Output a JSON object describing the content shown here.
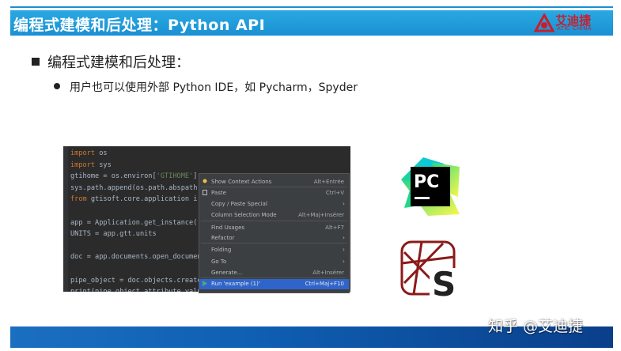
{
  "slide": {
    "title": "编程式建模和后处理：Python API",
    "heading": "编程式建模和后处理：",
    "bullet": "用户也可以使用外部 Python IDE，如 Pycharm，Spyder",
    "watermark": "知乎 @艾迪捷"
  },
  "logo": {
    "name_cn": "艾迪捷",
    "name_en": "ATIC CHINA",
    "color": "#c81e2c"
  },
  "ide": {
    "code_lines": [
      {
        "kw": "import",
        "rest": " os"
      },
      {
        "kw": "import",
        "rest": " sys"
      },
      {
        "pre": "gtihome = os.environ[",
        "str": "'GTIHOME'",
        "post": "]"
      },
      {
        "pre": "sys.path.append(os.path.abspath"
      },
      {
        "kw": "from",
        "rest": " gtisoft.core.application i"
      },
      {
        "pre": ""
      },
      {
        "pre": "app = Application.get_instance("
      },
      {
        "pre": "UNITS = app.gtt.units"
      },
      {
        "pre": ""
      },
      {
        "pre": "doc = app.documents.open_documen"
      },
      {
        "pre": ""
      },
      {
        "pre": "pipe_object = doc.objects.create"
      },
      {
        "pre": "print(pipe_object.attribute_valu"
      }
    ],
    "context_menu": [
      {
        "label": "Show Context Actions",
        "shortcut": "Alt+Entrée",
        "icon": "bulb-icon"
      },
      {
        "label": "Paste",
        "shortcut": "Ctrl+V",
        "icon": "clipboard-icon"
      },
      {
        "label": "Copy / Paste Special",
        "submenu": true
      },
      {
        "label": "Column Selection Mode",
        "shortcut": "Alt+Maj+Insérer"
      },
      {
        "label": "Find Usages",
        "shortcut": "Alt+F7"
      },
      {
        "label": "Refactor",
        "submenu": true
      },
      {
        "label": "Folding",
        "submenu": true
      },
      {
        "label": "Go To",
        "submenu": true
      },
      {
        "label": "Generate...",
        "shortcut": "Alt+Insérer"
      },
      {
        "label": "Run 'example (1)'",
        "shortcut": "Ctrl+Maj+F10",
        "icon": "run-icon",
        "selected": true
      }
    ]
  },
  "logos": {
    "pycharm_text": "PC",
    "spyder_letter": "S"
  }
}
